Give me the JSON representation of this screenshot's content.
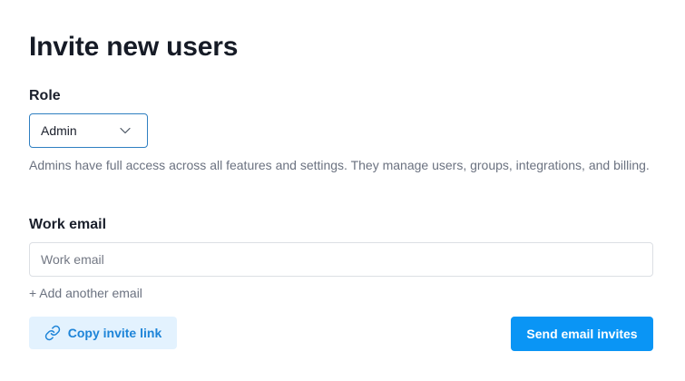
{
  "page": {
    "title": "Invite new users"
  },
  "role": {
    "label": "Role",
    "selected": "Admin",
    "help": "Admins have full access across all features and settings. They manage users, groups, integrations, and billing."
  },
  "email": {
    "label": "Work email",
    "placeholder": "Work email",
    "value": "",
    "add_another": "+ Add another email"
  },
  "actions": {
    "copy_link": "Copy invite link",
    "send_invites": "Send email invites"
  },
  "icons": {
    "role_select": "chevron-down-icon",
    "copy_link": "link-icon"
  },
  "colors": {
    "primary": "#0a95f5",
    "primary_text": "#1d84d8",
    "secondary_bg": "#e3f2fe",
    "muted_text": "#6b7280",
    "select_border": "#2f7fc1"
  }
}
